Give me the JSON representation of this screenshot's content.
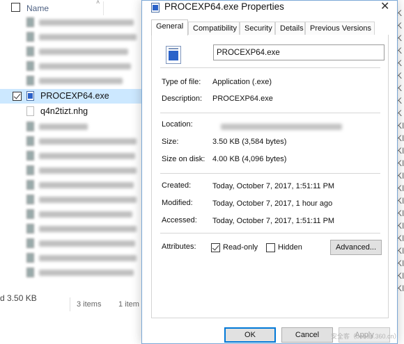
{
  "explorer": {
    "column_header": "Name",
    "selected_file": "PROCEXP64.exe",
    "other_file": "q4n2tizt.nhg",
    "status_size_prefix": "d",
    "status_size": "3.50 KB",
    "status_items": "3 items",
    "status_items2": "1 item",
    "right_letters": [
      "K",
      "K",
      "K",
      "K",
      "K",
      "K",
      "K",
      "K",
      "K",
      "KI",
      "KI",
      "KI",
      "KI",
      "KI",
      "KI",
      "KI",
      "KI",
      "KI",
      "KI",
      "KI",
      "KI",
      "KI",
      "KI"
    ]
  },
  "dialog": {
    "title": "PROCEXP64.exe Properties",
    "close_glyph": "✕",
    "tabs": [
      "General",
      "Compatibility",
      "Security",
      "Details",
      "Previous Versions"
    ],
    "active_tab": "General",
    "file_name": "PROCEXP64.exe",
    "fields": {
      "type_label": "Type of file:",
      "type_value": "Application (.exe)",
      "description_label": "Description:",
      "description_value": "PROCEXP64.exe",
      "location_label": "Location:",
      "size_label": "Size:",
      "size_value": "3.50 KB (3,584 bytes)",
      "size_on_disk_label": "Size on disk:",
      "size_on_disk_value": "4.00 KB (4,096 bytes)",
      "created_label": "Created:",
      "created_value": "Today, October 7, 2017, 1:51:11 PM",
      "modified_label": "Modified:",
      "modified_value": "Today, October 7, 2017, 1 hour ago",
      "accessed_label": "Accessed:",
      "accessed_value": "Today, October 7, 2017, 1:51:11 PM",
      "attributes_label": "Attributes:"
    },
    "attributes": {
      "read_only_label": "Read-only",
      "read_only_checked": true,
      "hidden_label": "Hidden",
      "hidden_checked": false,
      "advanced_button": "Advanced..."
    },
    "buttons": {
      "ok": "OK",
      "cancel": "Cancel",
      "apply": "Apply"
    },
    "watermark": "安全客（bobao.360.cn）"
  },
  "colors": {
    "selection": "#cce8ff",
    "accent": "#0078d7",
    "dialog_border": "#7aa7d6"
  }
}
